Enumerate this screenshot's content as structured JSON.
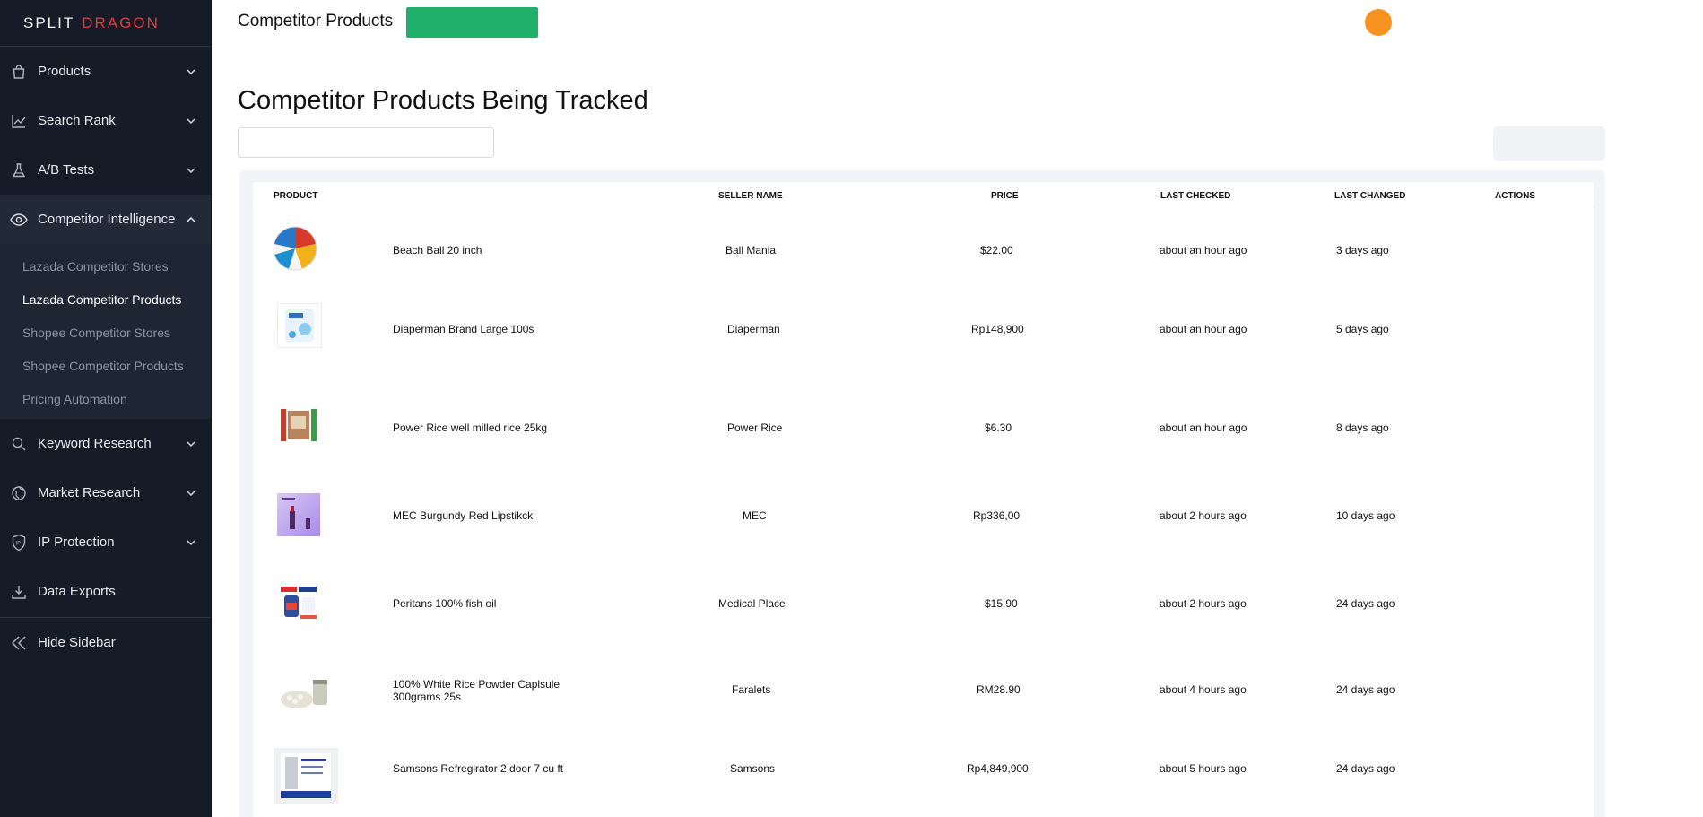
{
  "logo": {
    "part1": "SPLIT",
    "part2": "DRAGON"
  },
  "sidebar": {
    "items": [
      {
        "label": "Products"
      },
      {
        "label": "Search Rank"
      },
      {
        "label": "A/B Tests"
      },
      {
        "label": "Competitor Intelligence"
      },
      {
        "label": "Keyword Research"
      },
      {
        "label": "Market Research"
      },
      {
        "label": "IP Protection"
      },
      {
        "label": "Data Exports"
      }
    ],
    "subitems": [
      {
        "label": "Lazada Competitor Stores"
      },
      {
        "label": "Lazada Competitor Products"
      },
      {
        "label": "Shopee Competitor Stores"
      },
      {
        "label": "Shopee Competitor Products"
      },
      {
        "label": "Pricing Automation"
      }
    ],
    "hide_label": "Hide Sidebar"
  },
  "header": {
    "title": "Competitor Products"
  },
  "page": {
    "heading": "Competitor Products Being Tracked"
  },
  "table": {
    "headers": {
      "product": "PRODUCT",
      "seller": "SELLER NAME",
      "price": "PRICE",
      "last_checked": "LAST CHECKED",
      "last_changed": "LAST CHANGED",
      "actions": "ACTIONS"
    },
    "rows": [
      {
        "name": "Beach Ball 20 inch",
        "seller": "Ball Mania",
        "price": "$22.00",
        "checked": "about an hour ago",
        "changed": "3 days ago"
      },
      {
        "name": "Diaperman Brand Large 100s",
        "seller": "Diaperman",
        "price": "Rp148,900",
        "checked": "about an hour ago",
        "changed": "5 days ago"
      },
      {
        "name": "Power Rice well milled rice 25kg",
        "seller": "Power Rice",
        "price": "$6.30",
        "checked": "about an hour ago",
        "changed": "8 days ago"
      },
      {
        "name": "MEC Burgundy Red Lipstikck",
        "seller": "MEC",
        "price": "Rp336,00",
        "checked": "about 2 hours ago",
        "changed": "10 days ago"
      },
      {
        "name": "Peritans 100% fish oil",
        "seller": "Medical Place",
        "price": "$15.90",
        "checked": "about 2 hours ago",
        "changed": "24 days ago"
      },
      {
        "name": "100% White Rice Powder Caplsule 300grams 25s",
        "seller": "Faralets",
        "price": "RM28.90",
        "checked": "about 4 hours ago",
        "changed": "24 days ago"
      },
      {
        "name": "Samsons Refregirator 2 door 7 cu ft",
        "seller": "Samsons",
        "price": "Rp4,849,900",
        "checked": "about 5 hours ago",
        "changed": "24 days ago"
      }
    ]
  },
  "colors": {
    "sidebar_bg": "#161c27",
    "accent_green": "#21b06a",
    "avatar": "#f7931e",
    "logo_red": "#e23b3b"
  },
  "icons": [
    "shopping-bag-icon",
    "trend-chart-icon",
    "flask-icon",
    "eye-icon",
    "search-icon",
    "globe-icon",
    "shield-ip-icon",
    "download-icon",
    "double-chevron-left-icon",
    "chevron-down-icon",
    "chevron-up-icon"
  ]
}
